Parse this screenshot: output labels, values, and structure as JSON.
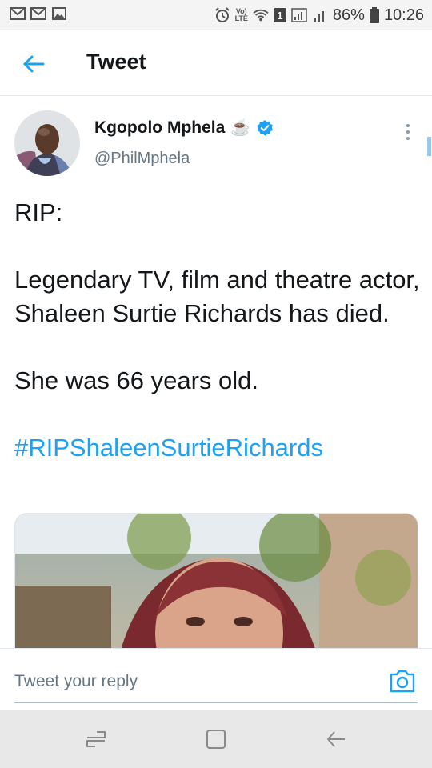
{
  "status_bar": {
    "battery": "86%",
    "time": "10:26",
    "volte_label": "Vo)\nLTE",
    "sim_badge": "1",
    "left_icons": [
      "gmail-icon",
      "gmail-icon",
      "image-icon"
    ],
    "right_icons": [
      "alarm-icon",
      "volte-icon",
      "wifi-icon",
      "sim-icon",
      "signal-icon",
      "signal-icon",
      "battery-icon"
    ]
  },
  "header": {
    "back_icon": "arrow-left-icon",
    "title": "Tweet"
  },
  "tweet": {
    "author": {
      "display_name": "Kgopolo Mphela",
      "emoji": "☕",
      "verified": true,
      "handle": "@PhilMphela"
    },
    "text": {
      "line1": "RIP:",
      "line2": "Legendary TV, film and theatre actor, Shaleen Surtie Richards has died.",
      "line3": "She was 66 years old.",
      "hashtag": "#RIPShaleenSurtieRichards"
    },
    "media": {
      "type": "photo"
    }
  },
  "reply": {
    "placeholder": "Tweet your reply",
    "camera_icon": "camera-icon"
  },
  "nav_bar": {
    "icons": [
      "recent-apps-icon",
      "home-icon",
      "back-icon"
    ]
  },
  "colors": {
    "accent": "#1da1f2",
    "text": "#14171a",
    "secondary_text": "#657786"
  }
}
